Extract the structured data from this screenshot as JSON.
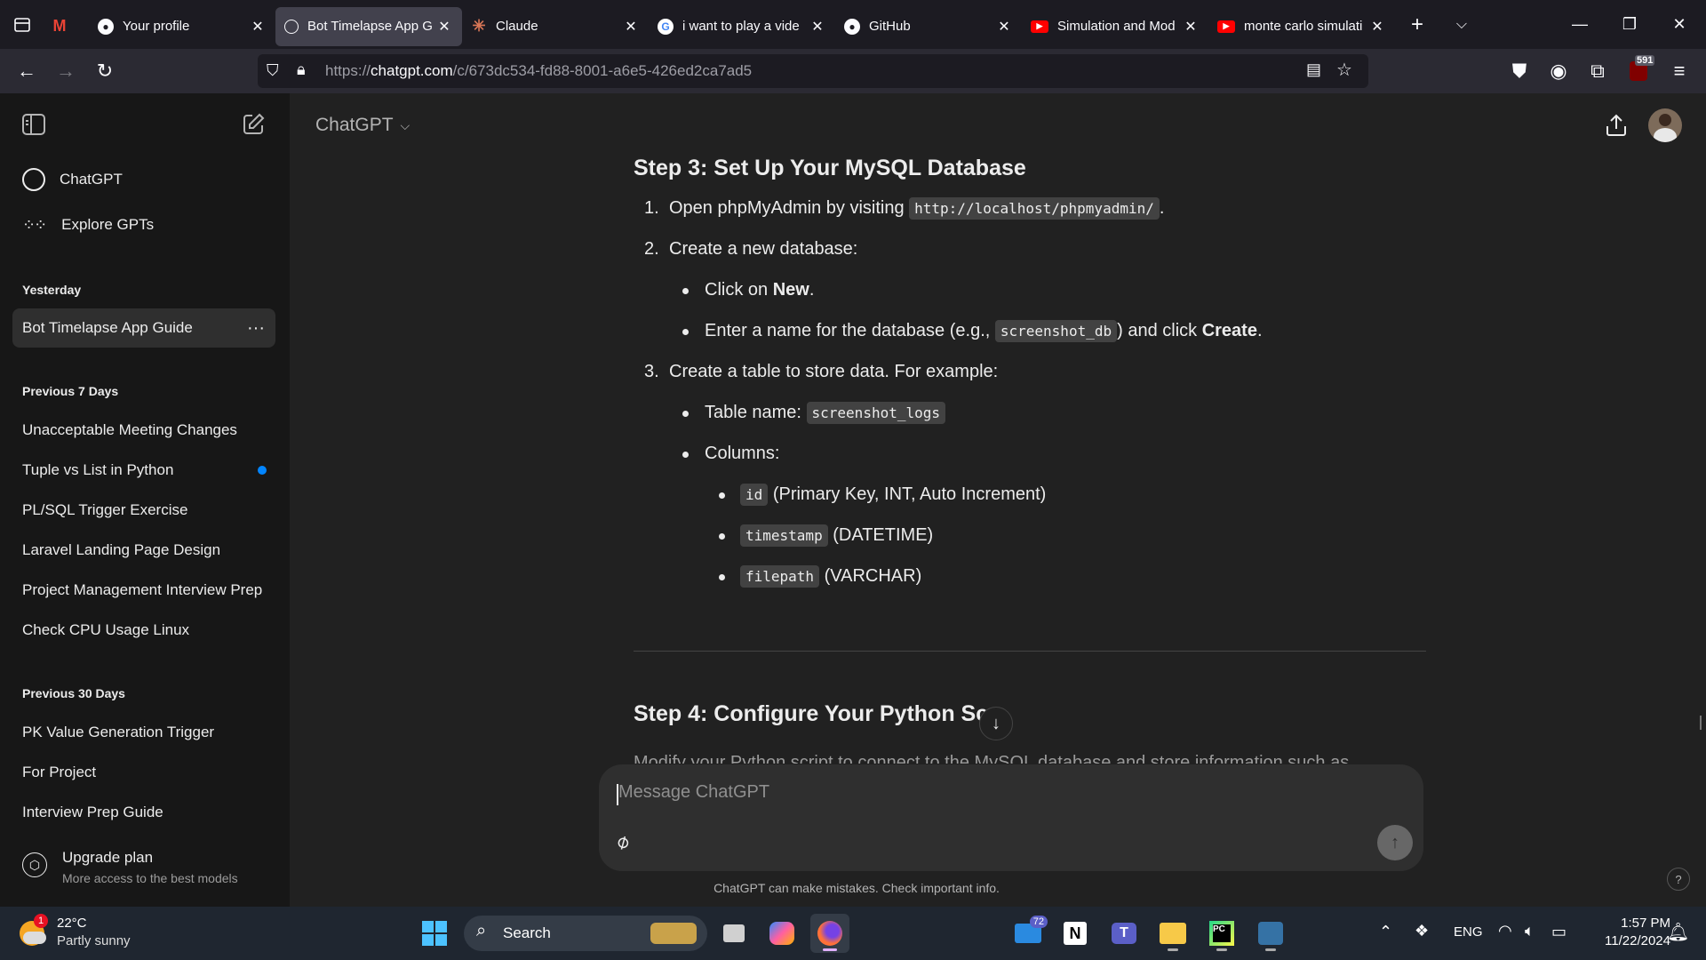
{
  "browser": {
    "tabs": [
      {
        "title": "",
        "icon": "gmail-icon",
        "color": "#ea4335"
      },
      {
        "title": "Your profile",
        "icon": "github-icon"
      },
      {
        "title": "Bot Timelapse App G",
        "icon": "chatgpt-icon",
        "active": true
      },
      {
        "title": "Claude",
        "icon": "claude-icon"
      },
      {
        "title": "i want to play a vide",
        "icon": "google-icon"
      },
      {
        "title": "GitHub",
        "icon": "github-icon"
      },
      {
        "title": "Simulation and Mod",
        "icon": "youtube-icon"
      },
      {
        "title": "monte carlo simulati",
        "icon": "youtube-icon"
      }
    ],
    "url_prefix": "https://",
    "url_host": "chatgpt.com",
    "url_path": "/c/673dc534-fd88-8001-a6e5-426ed2ca7ad5",
    "badge_count": "591"
  },
  "sidebar": {
    "items_top": [
      {
        "label": "ChatGPT",
        "icon": "chatgpt-icon"
      },
      {
        "label": "Explore GPTs",
        "icon": "grid-icon"
      }
    ],
    "sections": [
      {
        "heading": "Yesterday",
        "items": [
          "Bot Timelapse App Guide"
        ]
      },
      {
        "heading": "Previous 7 Days",
        "items": [
          "Unacceptable Meeting Changes",
          "Tuple vs List in Python",
          "PL/SQL Trigger Exercise",
          "Laravel Landing Page Design",
          "Project Management Interview Prep",
          "Check CPU Usage Linux"
        ]
      },
      {
        "heading": "Previous 30 Days",
        "items": [
          "PK Value Generation Trigger",
          "For Project",
          "Interview Prep Guide"
        ]
      }
    ],
    "upgrade_title": "Upgrade plan",
    "upgrade_sub": "More access to the best models"
  },
  "header": {
    "model": "ChatGPT"
  },
  "content": {
    "step3_prefix": "Step 3: ",
    "step3_title": "Set Up Your MySQL Database",
    "item1_num": "1.",
    "item1_text": "Open phpMyAdmin by visiting ",
    "item1_code": "http://localhost/phpmyadmin/",
    "item1_end": ".",
    "item2_num": "2.",
    "item2_text": "Create a new database:",
    "b1_pre": "Click on ",
    "b1_bold": "New",
    "b1_end": ".",
    "b2_pre": "Enter a name for the database (e.g., ",
    "b2_code": "screenshot_db",
    "b2_mid": ") and click ",
    "b2_bold": "Create",
    "b2_end": ".",
    "item3_num": "3.",
    "item3_text": "Create a table to store data. For example:",
    "tn_pre": "Table name: ",
    "tn_code": "screenshot_logs",
    "cols_label": "Columns:",
    "c1_code": "id",
    "c1_text": " (Primary Key, INT, Auto Increment)",
    "c2_code": "timestamp",
    "c2_text": " (DATETIME)",
    "c3_code": "filepath",
    "c3_text": " (VARCHAR)",
    "step4_prefix": "Step 4: ",
    "step4_title": "Configure Your Python Scr",
    "step4_cut": "Modify your Python script to connect to the MySQL database and store information such as"
  },
  "composer": {
    "placeholder": "Message ChatGPT",
    "disclaimer": "ChatGPT can make mistakes. Check important info.",
    "help": "?"
  },
  "taskbar": {
    "weather_temp": "22°C",
    "weather_desc": "Partly sunny",
    "weather_badge": "1",
    "search_label": "Search",
    "mail_badge": "72",
    "lang": "ENG",
    "time": "1:57 PM",
    "date": "11/22/2024"
  }
}
